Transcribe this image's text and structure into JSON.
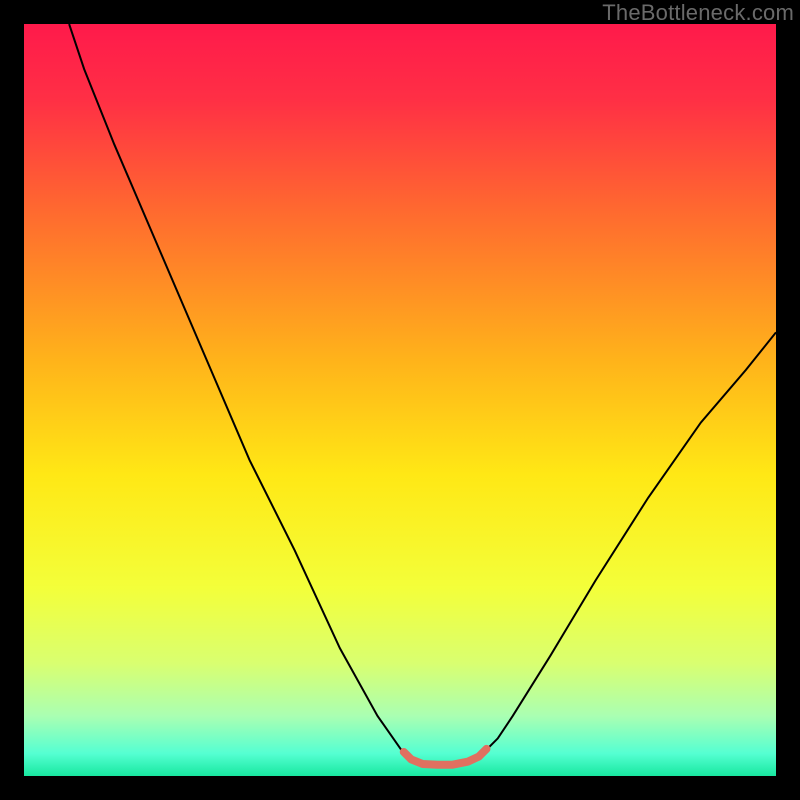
{
  "watermark": "TheBottleneck.com",
  "chart_data": {
    "type": "line",
    "title": "",
    "xlabel": "",
    "ylabel": "",
    "xlim": [
      0,
      100
    ],
    "ylim": [
      0,
      100
    ],
    "background_gradient": {
      "stops": [
        {
          "pos": 0.0,
          "color": "#ff1a4b"
        },
        {
          "pos": 0.1,
          "color": "#ff2f45"
        },
        {
          "pos": 0.25,
          "color": "#ff6a2f"
        },
        {
          "pos": 0.45,
          "color": "#ffb41a"
        },
        {
          "pos": 0.6,
          "color": "#ffe815"
        },
        {
          "pos": 0.75,
          "color": "#f3ff3a"
        },
        {
          "pos": 0.85,
          "color": "#d9ff70"
        },
        {
          "pos": 0.92,
          "color": "#aaffb2"
        },
        {
          "pos": 0.97,
          "color": "#55ffd2"
        },
        {
          "pos": 1.0,
          "color": "#18e8a0"
        }
      ]
    },
    "series": [
      {
        "name": "bottleneck-curve",
        "stroke": "#000000",
        "stroke_width": 2,
        "x": [
          6,
          8,
          12,
          18,
          24,
          30,
          36,
          42,
          47,
          50.5,
          52,
          54,
          57,
          59.5,
          61,
          63,
          65,
          70,
          76,
          83,
          90,
          96,
          100
        ],
        "y": [
          100,
          94,
          84,
          70,
          56,
          42,
          30,
          17,
          8,
          3,
          2,
          1.5,
          1.5,
          2,
          3,
          5,
          8,
          16,
          26,
          37,
          47,
          54,
          59
        ]
      },
      {
        "name": "optimal-range-marker",
        "stroke": "#e07060",
        "stroke_width": 8,
        "stroke_linecap": "round",
        "x": [
          50.5,
          51.5,
          53,
          55,
          57,
          59,
          60.5,
          61.5
        ],
        "y": [
          3.2,
          2.2,
          1.6,
          1.5,
          1.5,
          1.9,
          2.6,
          3.6
        ]
      }
    ]
  }
}
